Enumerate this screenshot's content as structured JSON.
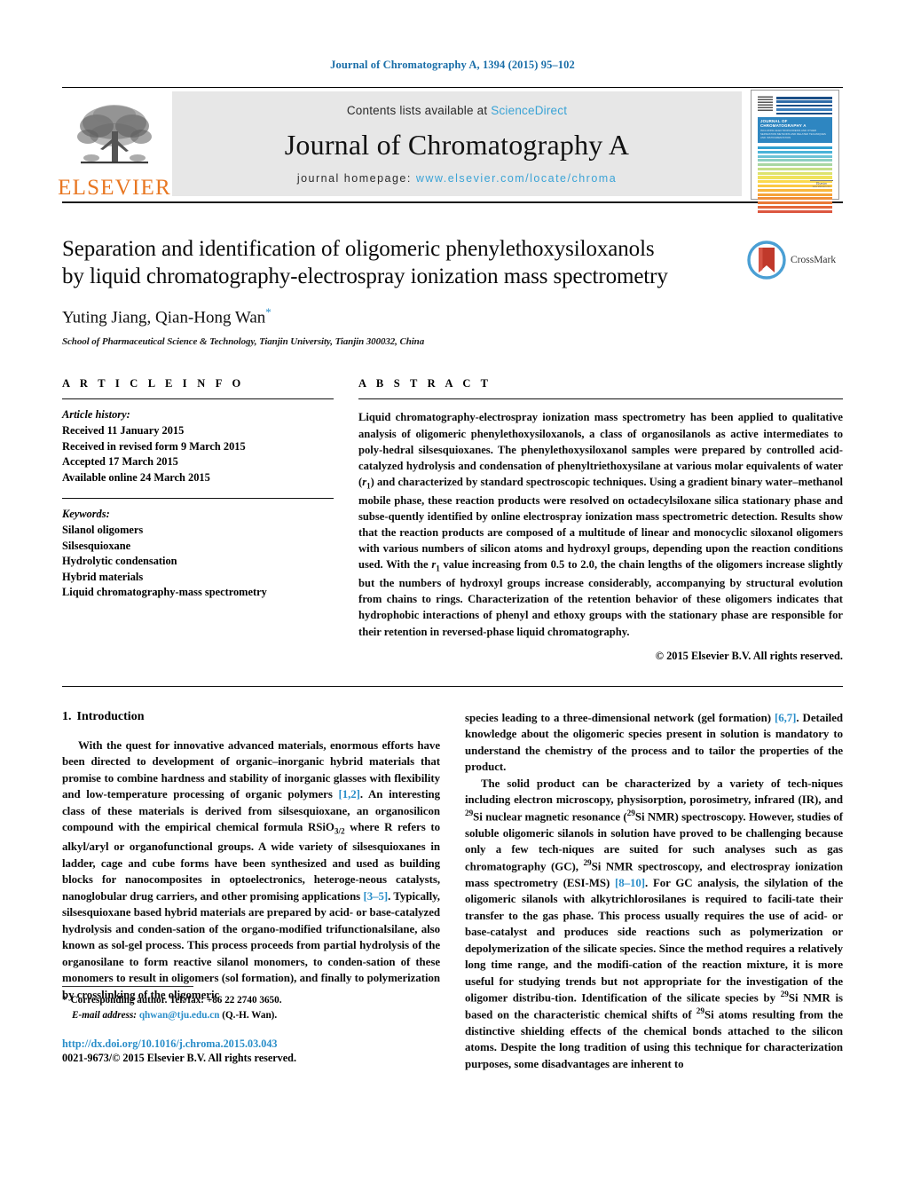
{
  "running_head": "Journal of Chromatography A, 1394 (2015) 95–102",
  "masthead": {
    "contents_prefix": "Contents lists available at",
    "contents_link": "ScienceDirect",
    "journal_title": "Journal of Chromatography A",
    "homepage_prefix": "journal homepage:",
    "homepage_url": "www.elsevier.com/locate/chroma",
    "publisher_wordmark": "ELSEVIER",
    "cover": {
      "title": "JOURNAL OF CHROMATOGRAPHY A",
      "subtitle": "INCLUDING ELECTROPHORESIS AND OTHER SEPARATION METHODS AND RELATED TECHNIQUES AND INSTRUMENTATION",
      "footer_word": "Elsevier",
      "footer_sub": "www.elsevier.com"
    }
  },
  "article": {
    "title_line1": "Separation and identification of oligomeric phenylethoxysiloxanols",
    "title_line2": "by liquid chromatography-electrospray ionization mass spectrometry",
    "authors": "Yuting Jiang, Qian-Hong Wan",
    "author_star": "*",
    "affiliation": "School of Pharmaceutical Science & Technology, Tianjin University, Tianjin 300032, China",
    "crossmark_label": "CrossMark"
  },
  "article_info": {
    "heading": "A R T I C L E   I N F O",
    "history_label": "Article history:",
    "history": [
      "Received 11 January 2015",
      "Received in revised form 9 March 2015",
      "Accepted 17 March 2015",
      "Available online 24 March 2015"
    ],
    "keywords_label": "Keywords:",
    "keywords": [
      "Silanol oligomers",
      "Silsesquioxane",
      "Hydrolytic condensation",
      "Hybrid materials",
      "Liquid chromatography-mass spectrometry"
    ]
  },
  "abstract": {
    "heading": "A B S T R A C T",
    "text_part1": "Liquid chromatography-electrospray ionization mass spectrometry has been applied to qualitative analysis of oligomeric phenylethoxysiloxanols, a class of organosilanols as active intermediates to poly-hedral silsesquioxanes. The phenylethoxysiloxanol samples were prepared by controlled acid-catalyzed hydrolysis and condensation of phenyltriethoxysilane at various molar equivalents of water (",
    "r1_symbol": "r",
    "r1_sub": "1",
    "text_part2": ") and characterized by standard spectroscopic techniques. Using a gradient binary water–methanol mobile phase, these reaction products were resolved on octadecylsiloxane silica stationary phase and subse-quently identified by online electrospray ionization mass spectrometric detection. Results show that the reaction products are composed of a multitude of linear and monocyclic siloxanol oligomers with various numbers of silicon atoms and hydroxyl groups, depending upon the reaction conditions used. With the ",
    "text_part3": " value increasing from 0.5 to 2.0, the chain lengths of the oligomers increase slightly but the numbers of hydroxyl groups increase considerably, accompanying by structural evolution from chains to rings. Characterization of the retention behavior of these oligomers indicates that hydrophobic interactions of phenyl and ethoxy groups with the stationary phase are responsible for their retention in reversed-phase liquid chromatography.",
    "copyright": "© 2015 Elsevier B.V. All rights reserved."
  },
  "introduction": {
    "section_number": "1.",
    "section_title": "Introduction",
    "left_p1_a": "With the quest for innovative advanced materials, enormous efforts have been directed to development of organic–inorganic hybrid materials that promise to combine hardness and stability of inorganic glasses with flexibility and low-temperature processing of organic polymers ",
    "ref_1_2": "[1,2]",
    "left_p1_b": ". An interesting class of these materials is derived from silsesquioxane, an organosilicon compound with the empirical chemical formula RSiO",
    "rsio_sub": "3/2",
    "left_p1_c": " where R refers to alkyl/aryl or organofunctional groups. A wide variety of silsesquioxanes in ladder, cage and cube forms have been synthesized and used as building blocks for nanocomposites in optoelectronics, heteroge-neous catalysts, nanoglobular drug carriers, and other promising applications ",
    "ref_3_5": "[3–5]",
    "left_p1_d": ". Typically, silsesquioxane based hybrid materials are prepared by acid- or base-catalyzed hydrolysis and conden-sation of the organo-modified trifunctionalsilane, also known as sol-gel process. This process proceeds from partial hydrolysis of the organosilane to form reactive silanol monomers, to conden-sation of these monomers to result in oligomers (sol formation), and finally to polymerization by crosslinking of the oligomeric",
    "right_p1_a": "species leading to a three-dimensional network (gel formation) ",
    "ref_6_7": "[6,7]",
    "right_p1_b": ". Detailed knowledge about the oligomeric species present in solution is mandatory to understand the chemistry of the process and to tailor the properties of the product.",
    "right_p2_a": "The solid product can be characterized by a variety of tech-niques including electron microscopy, physisorption, porosimetry, infrared (IR), and ",
    "si29": "29",
    "right_p2_b": "Si nuclear magnetic resonance (",
    "right_p2_c": "Si NMR) spectroscopy. However, studies of soluble oligomeric silanols in solution have proved to be challenging because only a few tech-niques are suited for such analyses such as gas chromatography (GC), ",
    "right_p2_d": "Si NMR spectroscopy, and electrospray ionization mass spectrometry (ESI-MS) ",
    "ref_8_10": "[8–10]",
    "right_p2_e": ". For GC analysis, the silylation of the oligomeric silanols with alkytrichlorosilanes is required to facili-tate their transfer to the gas phase. This process usually requires the use of acid- or base-catalyst and produces side reactions such as polymerization or depolymerization of the silicate species. Since the method requires a relatively long time range, and the modifi-cation of the reaction mixture, it is more useful for studying trends but not appropriate for the investigation of the oligomer distribu-tion. Identification of the silicate species by ",
    "right_p2_f": "Si NMR is based on the characteristic chemical shifts of ",
    "right_p2_g": "Si atoms resulting from the distinctive shielding effects of the chemical bonds attached to the silicon atoms. Despite the long tradition of using this technique for characterization purposes, some disadvantages are inherent to"
  },
  "footer": {
    "corresponding_star": "*",
    "corresponding_text": "Corresponding author. Tel./fax: +86 22 2740 3650.",
    "email_label": "E-mail address:",
    "email": "qhwan@tju.edu.cn",
    "email_owner": "(Q.-H. Wan).",
    "doi": "http://dx.doi.org/10.1016/j.chroma.2015.03.043",
    "issn_line": "0021-9673/© 2015 Elsevier B.V. All rights reserved."
  },
  "colors": {
    "link_blue": "#2a8ec9",
    "header_blue": "#1a6ea8",
    "elsevier_orange": "#E87722",
    "masthead_grey": "#e7e7e7",
    "crossmark_blue": "#4a9fd4",
    "crossmark_red": "#c0392b"
  }
}
